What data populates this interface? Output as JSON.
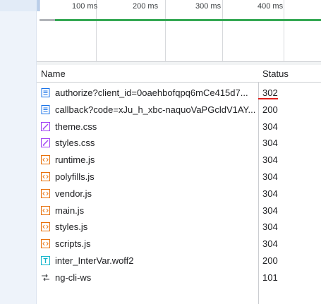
{
  "timeline": {
    "ticks": [
      "100 ms",
      "200 ms",
      "300 ms",
      "400 ms"
    ]
  },
  "table": {
    "headers": {
      "name": "Name",
      "status": "Status"
    },
    "rows": [
      {
        "name": "authorize?client_id=0oaehbofqpq6mCe415d7...",
        "status": "302",
        "icon": "document-icon"
      },
      {
        "name": "callback?code=xJu_h_xbc-naquoVaPGcldV1AY...",
        "status": "200",
        "icon": "document-icon"
      },
      {
        "name": "theme.css",
        "status": "304",
        "icon": "stylesheet-icon"
      },
      {
        "name": "styles.css",
        "status": "304",
        "icon": "stylesheet-icon"
      },
      {
        "name": "runtime.js",
        "status": "304",
        "icon": "script-icon"
      },
      {
        "name": "polyfills.js",
        "status": "304",
        "icon": "script-icon"
      },
      {
        "name": "vendor.js",
        "status": "304",
        "icon": "script-icon"
      },
      {
        "name": "main.js",
        "status": "304",
        "icon": "script-icon"
      },
      {
        "name": "styles.js",
        "status": "304",
        "icon": "script-icon"
      },
      {
        "name": "scripts.js",
        "status": "304",
        "icon": "script-icon"
      },
      {
        "name": "inter_InterVar.woff2",
        "status": "200",
        "icon": "font-icon"
      },
      {
        "name": "ng-cli-ws",
        "status": "101",
        "icon": "websocket-icon"
      }
    ]
  },
  "colors": {
    "timing_bar": "#34a853",
    "status_underline": "#e0201c",
    "document_icon": "#1a73e8",
    "stylesheet_icon": "#a142f4",
    "script_icon": "#e8710a",
    "font_icon": "#12b5cb"
  }
}
